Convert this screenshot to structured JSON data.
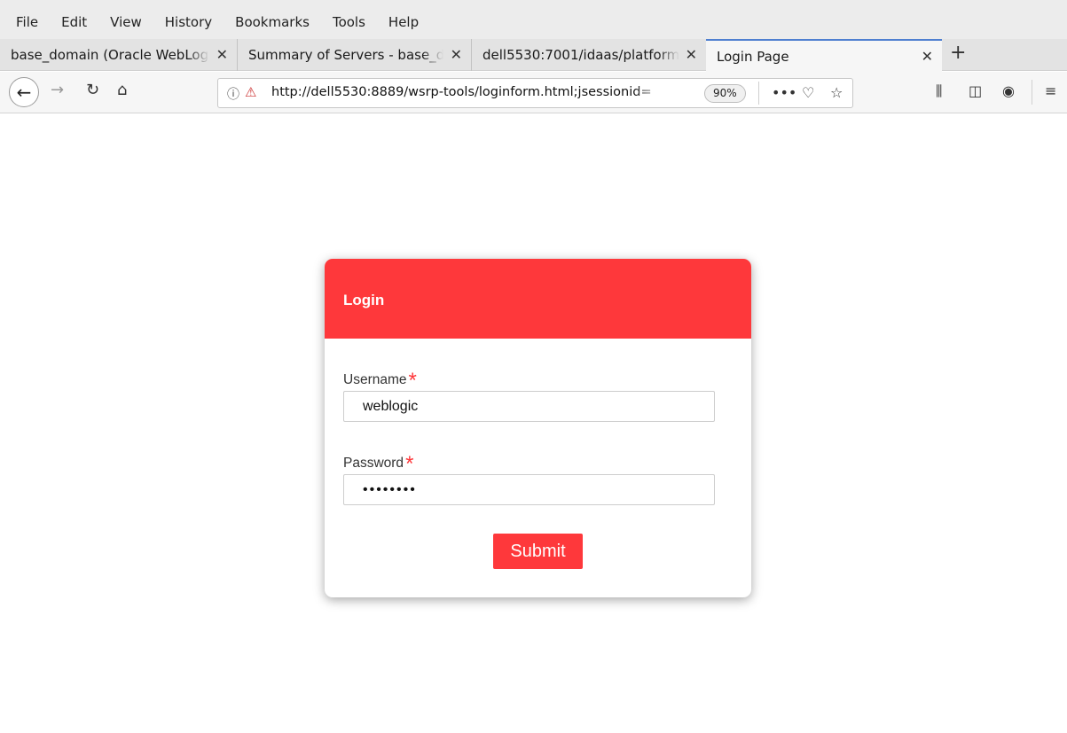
{
  "menu": [
    "File",
    "Edit",
    "View",
    "History",
    "Bookmarks",
    "Tools",
    "Help"
  ],
  "tabs": [
    {
      "title": "base_domain (Oracle WebLogic",
      "close": "✕"
    },
    {
      "title": "Summary of Servers - base_domain",
      "close": "✕"
    },
    {
      "title": "dell5530:7001/idaas/platform",
      "close": "✕"
    },
    {
      "title": "Login Page",
      "close": "✕"
    }
  ],
  "new_tab": "+",
  "nav": {
    "back_icon": "arrow-left-icon",
    "url": "http://dell5530:8889/wsrp-tools/loginform.html;jsessionid=",
    "zoom": "90%"
  },
  "login": {
    "title": "Login",
    "username_label": "Username",
    "username_value": "weblogic",
    "password_label": "Password",
    "password_value": "••••••••",
    "required_mark": "*",
    "submit_label": "Submit"
  },
  "colors": {
    "accent": "#fe383b",
    "tab_active_border": "#4e7fd0"
  }
}
